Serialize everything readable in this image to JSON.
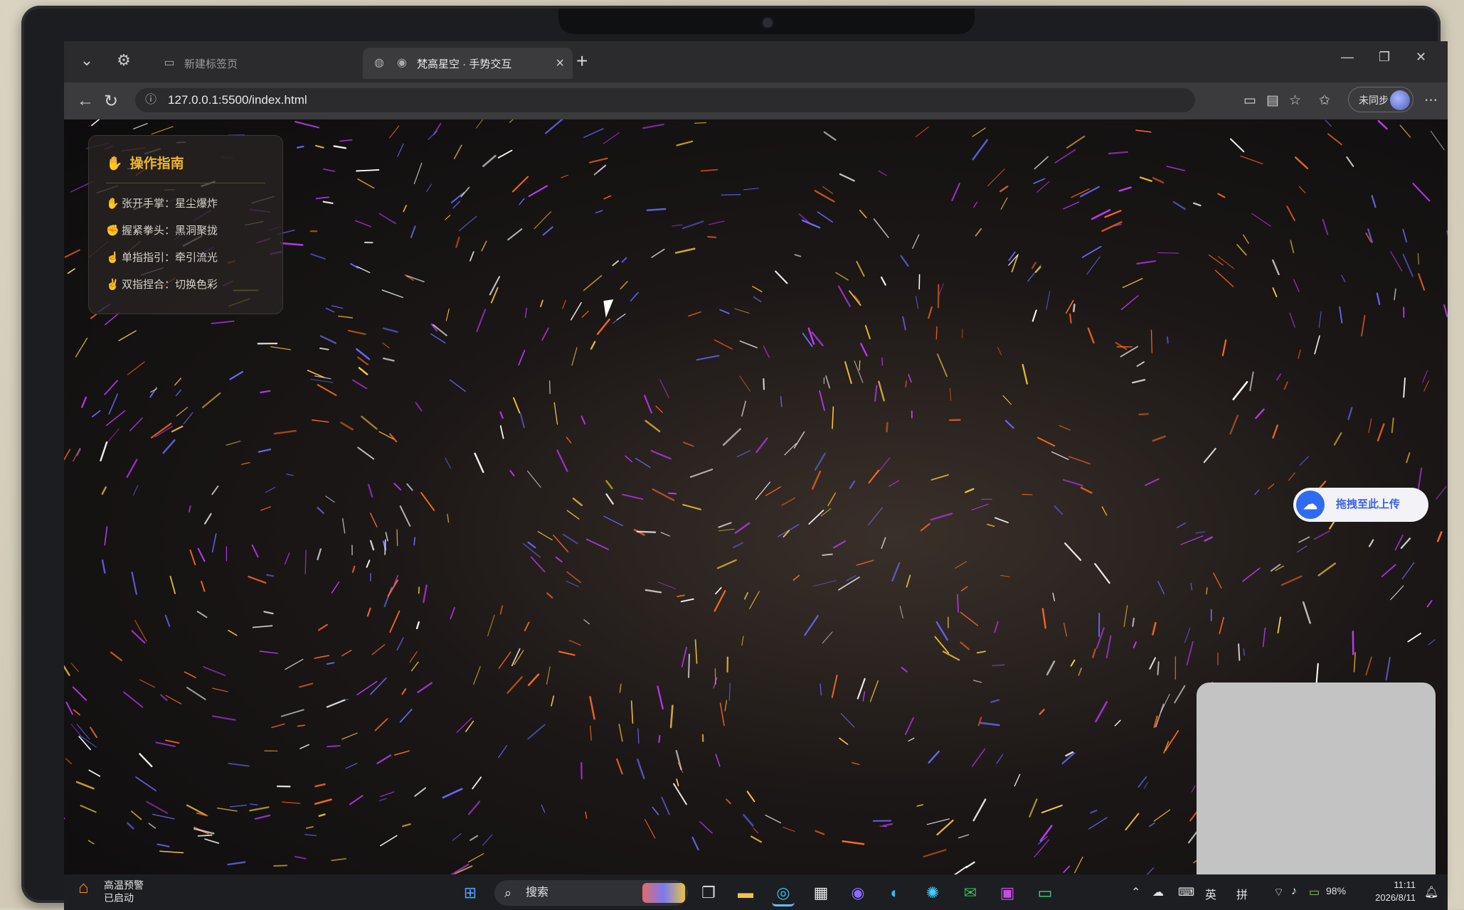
{
  "browser": {
    "tabs": [
      {
        "title": "新建标签页",
        "active": false
      },
      {
        "title": "梵高星空 · 手势交互",
        "active": true
      }
    ],
    "url": "127.0.0.1:5500/index.html",
    "sync_label": "未同步"
  },
  "guide": {
    "title": "操作指南",
    "items": [
      {
        "icon": "open-palm-icon",
        "text": "张开手掌：星尘爆炸"
      },
      {
        "icon": "fist-icon",
        "text": "握紧拳头：黑洞聚拢"
      },
      {
        "icon": "pointing-finger-icon",
        "text": "单指指引：牵引流光"
      },
      {
        "icon": "pinch-icon",
        "text": "双指捏合：切换色彩"
      }
    ]
  },
  "upload_widget": {
    "label": "拖拽至此上传"
  },
  "taskbar": {
    "weather_title": "高温预警",
    "weather_status": "已启动",
    "search_label": "搜索",
    "ime_lang": "英",
    "ime_mode": "拼",
    "battery": "98%",
    "time": "11:11",
    "date": "2026/8/11"
  },
  "colors": {
    "accent": "#f1b52a",
    "background": "#0d0c0d",
    "particle_palette": [
      "#ff6a1f",
      "#ffcf3a",
      "#6b6bff",
      "#ffffff",
      "#c43cff"
    ]
  }
}
